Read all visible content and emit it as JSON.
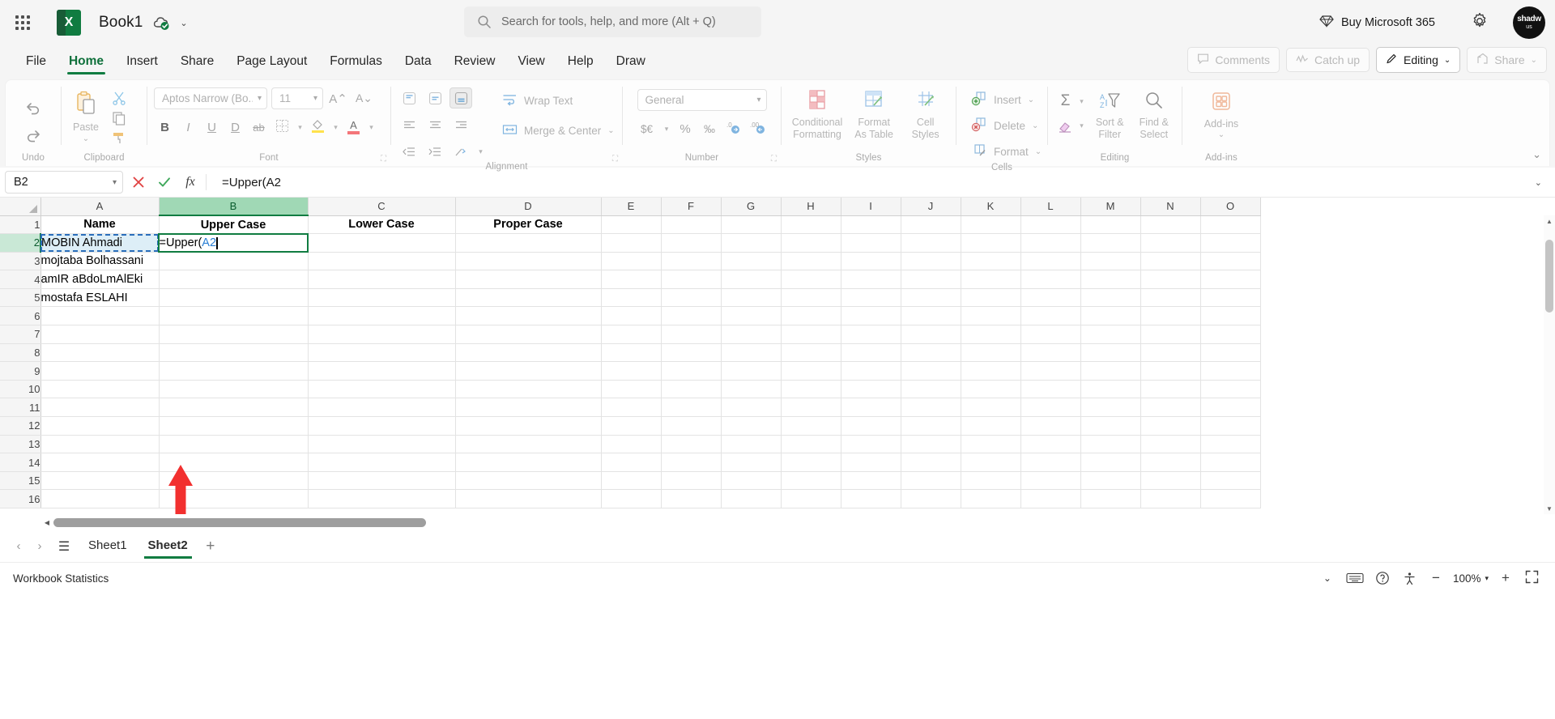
{
  "titlebar": {
    "app_launcher": "app-launcher",
    "app_icon_letter": "X",
    "document_title": "Book1",
    "cloud_status_icon": "cloud-saved-icon",
    "title_chevron": "⌄",
    "buy_label": "Buy Microsoft 365",
    "settings_icon": "gear-icon",
    "avatar_line1": "shadw",
    "avatar_line2": "us"
  },
  "search": {
    "placeholder": "Search for tools, help, and more (Alt + Q)",
    "icon": "search-icon"
  },
  "ribbon_tabs": [
    {
      "label": "File",
      "active": false
    },
    {
      "label": "Home",
      "active": true
    },
    {
      "label": "Insert",
      "active": false
    },
    {
      "label": "Share",
      "active": false
    },
    {
      "label": "Page Layout",
      "active": false
    },
    {
      "label": "Formulas",
      "active": false
    },
    {
      "label": "Data",
      "active": false
    },
    {
      "label": "Review",
      "active": false
    },
    {
      "label": "View",
      "active": false
    },
    {
      "label": "Help",
      "active": false
    },
    {
      "label": "Draw",
      "active": false
    }
  ],
  "tab_actions": {
    "comments": "Comments",
    "catch_up": "Catch up",
    "editing": "Editing",
    "editing_caret": "⌄",
    "share": "Share",
    "share_caret": "⌄"
  },
  "ribbon": {
    "groups": {
      "undo": {
        "label": "Undo",
        "undo_icon": "undo-icon",
        "redo_icon": "redo-icon"
      },
      "clipboard": {
        "label": "Clipboard",
        "paste_label": "Paste",
        "paste_caret": "⌄",
        "cut_icon": "scissors-icon",
        "copy_icon": "copy-icon",
        "format_painter_icon": "format-painter-icon"
      },
      "font": {
        "label": "Font",
        "font_name": "Aptos Narrow (Bo...",
        "font_size": "11",
        "grow_font": "A⌃",
        "shrink_font": "A⌄",
        "bold": "B",
        "italic": "I",
        "underline": "U",
        "double_underline": "D",
        "strikethrough": "ab",
        "borders_icon": "borders-icon",
        "fill_color_icon": "fill-color-icon",
        "font_color_letter": "A"
      },
      "alignment": {
        "label": "Alignment",
        "align_top": "align-top-icon",
        "align_middle": "align-middle-icon",
        "align_bottom": "align-bottom-icon",
        "align_left": "align-left-icon",
        "align_center": "align-center-icon",
        "align_right": "align-right-icon",
        "decrease_indent": "decrease-indent-icon",
        "increase_indent": "increase-indent-icon",
        "orientation": "orientation-icon",
        "wrap_text": "Wrap Text",
        "merge_center": "Merge & Center",
        "merge_caret": "⌄"
      },
      "number": {
        "label": "Number",
        "format": "General",
        "format_caret": "⌄",
        "currency": "$€",
        "currency_caret": "⌄",
        "percent": "%",
        "comma": "‰",
        "increase_decimal": "increase-decimal-icon",
        "decrease_decimal": "decrease-decimal-icon"
      },
      "styles": {
        "label": "Styles",
        "conditional_formatting": "Conditional Formatting",
        "format_as_table": "Format As Table",
        "cell_styles": "Cell Styles",
        "caret": "⌄"
      },
      "cells": {
        "label": "Cells",
        "insert": "Insert",
        "delete": "Delete",
        "format": "Format",
        "caret": "⌄"
      },
      "editing": {
        "label": "Editing",
        "autosum": "Σ",
        "clear_icon": "eraser-icon",
        "sort_filter": "Sort & Filter",
        "find_select": "Find & Select",
        "caret": "⌄"
      },
      "addins": {
        "label": "Add-ins",
        "title": "Add-ins",
        "caret": "⌄",
        "icon": "addins-icon"
      }
    },
    "collapse_caret": "⌄"
  },
  "formula_bar": {
    "name_box": "B2",
    "name_box_caret": "⌄",
    "cancel_icon": "cancel-x-icon",
    "enter_icon": "enter-check-icon",
    "function_icon": "fx",
    "formula_text": "=Upper(A2",
    "formula_function_part": "=Upper(",
    "formula_reference_part": "A2",
    "expand_caret": "⌄"
  },
  "grid": {
    "columns": [
      "A",
      "B",
      "C",
      "D",
      "E",
      "F",
      "G",
      "H",
      "I",
      "J",
      "K",
      "L",
      "M",
      "N",
      "O"
    ],
    "selected_column": "B",
    "selected_row": 2,
    "rows": [
      1,
      2,
      3,
      4,
      5,
      6,
      7,
      8,
      9,
      10,
      11,
      12,
      13,
      14,
      15,
      16
    ],
    "headers_row": {
      "A": "Name",
      "B": "Upper Case",
      "C": "Lower Case",
      "D": "Proper Case"
    },
    "data": [
      {
        "row": 2,
        "A": "MOBIN Ahmadi",
        "B": "=Upper(A2"
      },
      {
        "row": 3,
        "A": "mojtaba Bolhassani",
        "B": ""
      },
      {
        "row": 4,
        "A": "amIR aBdoLmAlEki",
        "B": ""
      },
      {
        "row": 5,
        "A": "mostafa ESLAHI",
        "B": ""
      }
    ],
    "source_cell": "A2",
    "editing_cell": "B2",
    "annotation": {
      "type": "red-arrow-up",
      "color": "#f2302f",
      "points_to": "B2"
    }
  },
  "sheet_tabs": {
    "prev_icon": "‹",
    "next_icon": "›",
    "all_sheets_icon": "☰",
    "tabs": [
      {
        "label": "Sheet1",
        "active": false
      },
      {
        "label": "Sheet2",
        "active": true
      }
    ],
    "add_icon": "+"
  },
  "status_bar": {
    "workbook_statistics": "Workbook Statistics",
    "caret": "⌄",
    "keyboard_icon": "keyboard-icon",
    "help_icon": "help-icon",
    "accessibility_icon": "accessibility-icon",
    "zoom_out": "−",
    "zoom_level": "100%",
    "zoom_in": "+",
    "fullscreen_icon": "fullscreen-icon"
  },
  "colors": {
    "excel_green": "#107c41",
    "selection_green": "#a0d8b5",
    "ref_blue": "#2a7fd4",
    "arrow_red": "#f2302f"
  }
}
